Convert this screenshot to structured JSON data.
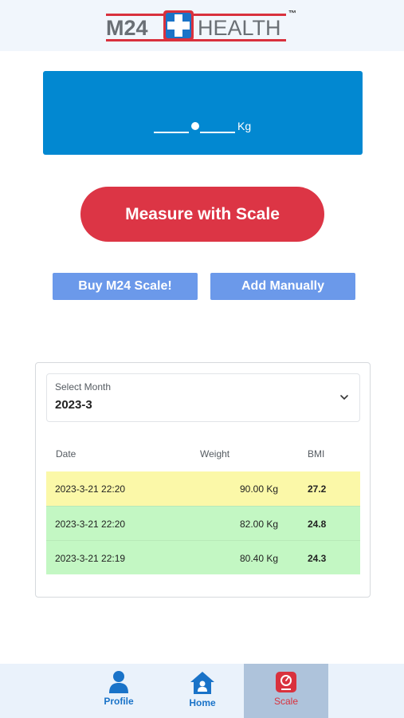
{
  "header": {
    "logo_left": "M24",
    "logo_right": "HEALTH",
    "logo_tm": "™"
  },
  "weight_display": {
    "unit": "Kg"
  },
  "actions": {
    "measure_label": "Measure with Scale",
    "buy_label": "Buy M24 Scale!",
    "add_label": "Add Manually"
  },
  "history": {
    "select_label": "Select Month",
    "selected_month": "2023-3",
    "columns": [
      "Date",
      "Weight",
      "BMI"
    ],
    "rows": [
      {
        "date": "2023-3-21 22:20",
        "weight": "90.00 Kg",
        "bmi": "27.2",
        "status_color": "#fbf8a8"
      },
      {
        "date": "2023-3-21 22:20",
        "weight": "82.00 Kg",
        "bmi": "24.8",
        "status_color": "#c3f7c3"
      },
      {
        "date": "2023-3-21 22:19",
        "weight": "80.40 Kg",
        "bmi": "24.3",
        "status_color": "#c3f7c3"
      }
    ]
  },
  "bottom_nav": {
    "items": [
      {
        "label": "Profile",
        "icon": "person-icon"
      },
      {
        "label": "Home",
        "icon": "home-icon"
      },
      {
        "label": "Scale",
        "icon": "scale-icon",
        "active": true
      }
    ]
  },
  "colors": {
    "accent_blue": "#0288d1",
    "measure_red": "#dc3545",
    "secondary_button": "#6b99ea",
    "nav_active_bg": "#aec3db"
  }
}
